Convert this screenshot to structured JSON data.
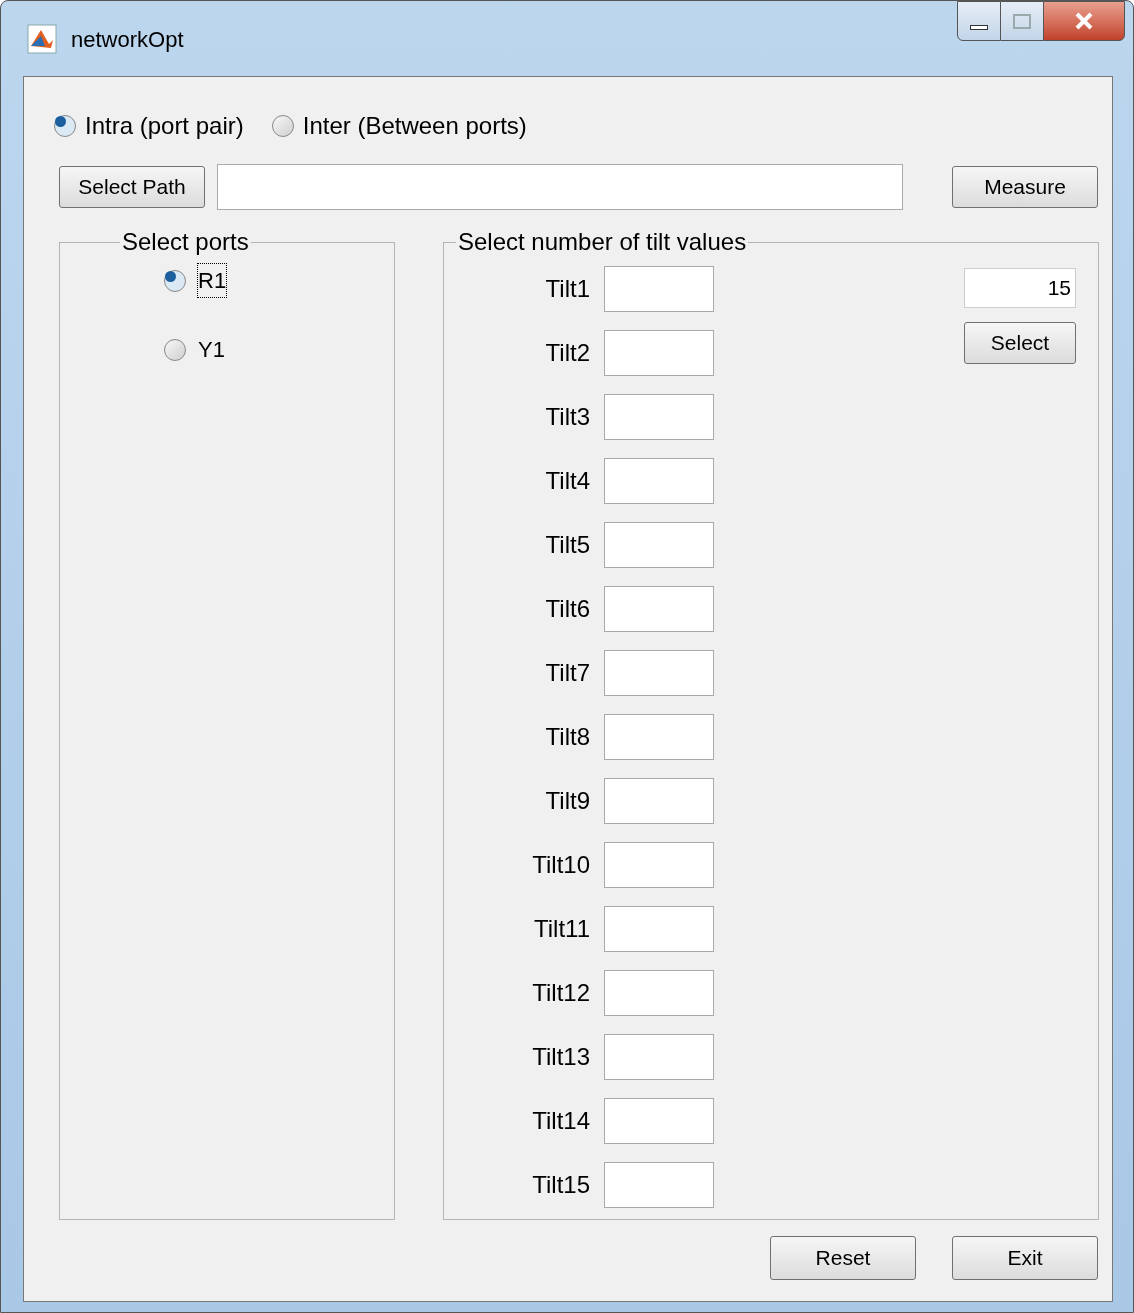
{
  "window": {
    "title": "networkOpt"
  },
  "mode_options": [
    {
      "label": "Intra (port pair)",
      "selected": true
    },
    {
      "label": "Inter (Between ports)",
      "selected": false
    }
  ],
  "path_button": "Select Path",
  "measure_button": "Measure",
  "ports_panel": {
    "title": "Select ports",
    "options": [
      {
        "label": "R1",
        "selected": true,
        "focused": true
      },
      {
        "label": "Y1",
        "selected": false,
        "focused": false
      }
    ]
  },
  "tilt_panel": {
    "title": "Select number of tilt values",
    "count_field": {
      "value": "15"
    },
    "select_button": "Select",
    "tilts": [
      {
        "label": "Tilt1"
      },
      {
        "label": "Tilt2"
      },
      {
        "label": "Tilt3"
      },
      {
        "label": "Tilt4"
      },
      {
        "label": "Tilt5"
      },
      {
        "label": "Tilt6"
      },
      {
        "label": "Tilt7"
      },
      {
        "label": "Tilt8"
      },
      {
        "label": "Tilt9"
      },
      {
        "label": "Tilt10"
      },
      {
        "label": "Tilt11"
      },
      {
        "label": "Tilt12"
      },
      {
        "label": "Tilt13"
      },
      {
        "label": "Tilt14"
      },
      {
        "label": "Tilt15"
      }
    ]
  },
  "buttons": [
    "Reset",
    "Exit"
  ]
}
